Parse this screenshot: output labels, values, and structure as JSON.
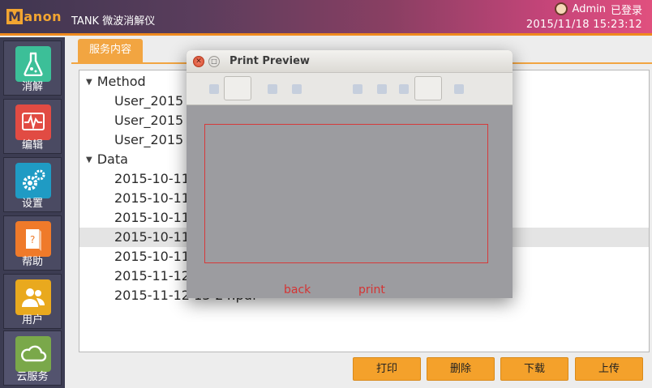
{
  "header": {
    "logo_text": "Manon",
    "app_title": "TANK 微波消解仪",
    "user_name": "Admin",
    "login_status": "已登录",
    "datetime": "2015/11/18 15:23:12",
    "accent_color": "#ef8a1e"
  },
  "sidebar": {
    "items": [
      {
        "label": "消解",
        "icon": "flask-icon",
        "color": "#3cbf98"
      },
      {
        "label": "编辑",
        "icon": "waveform-icon",
        "color": "#e14b43"
      },
      {
        "label": "设置",
        "icon": "gears-icon",
        "color": "#1f9bc4"
      },
      {
        "label": "帮助",
        "icon": "help-book-icon",
        "color": "#ef7a2a"
      },
      {
        "label": "用户",
        "icon": "users-icon",
        "color": "#e9a91e"
      },
      {
        "label": "云服务",
        "icon": "cloud-icon",
        "color": "#7aa84a"
      }
    ]
  },
  "main": {
    "tab_label": "服务内容",
    "tree": [
      {
        "text": "Method",
        "type": "folder"
      },
      {
        "text": "User_2015",
        "type": "item"
      },
      {
        "text": "User_2015",
        "type": "item"
      },
      {
        "text": "User_2015",
        "type": "item"
      },
      {
        "text": "Data",
        "type": "folder"
      },
      {
        "text": "2015-10-11",
        "type": "item"
      },
      {
        "text": "2015-10-11",
        "type": "item"
      },
      {
        "text": "2015-10-11",
        "type": "item"
      },
      {
        "text": "2015-10-11",
        "type": "item",
        "selected": true
      },
      {
        "text": "2015-10-11",
        "type": "item"
      },
      {
        "text": "2015-11-12",
        "type": "item"
      },
      {
        "text": "2015-11-12 13-24.pdf",
        "type": "item"
      }
    ],
    "buttons": {
      "print": "打印",
      "delete": "删除",
      "download": "下载",
      "upload": "上传"
    }
  },
  "dialog": {
    "title": "Print Preview",
    "back_label": "back",
    "print_label": "print"
  }
}
